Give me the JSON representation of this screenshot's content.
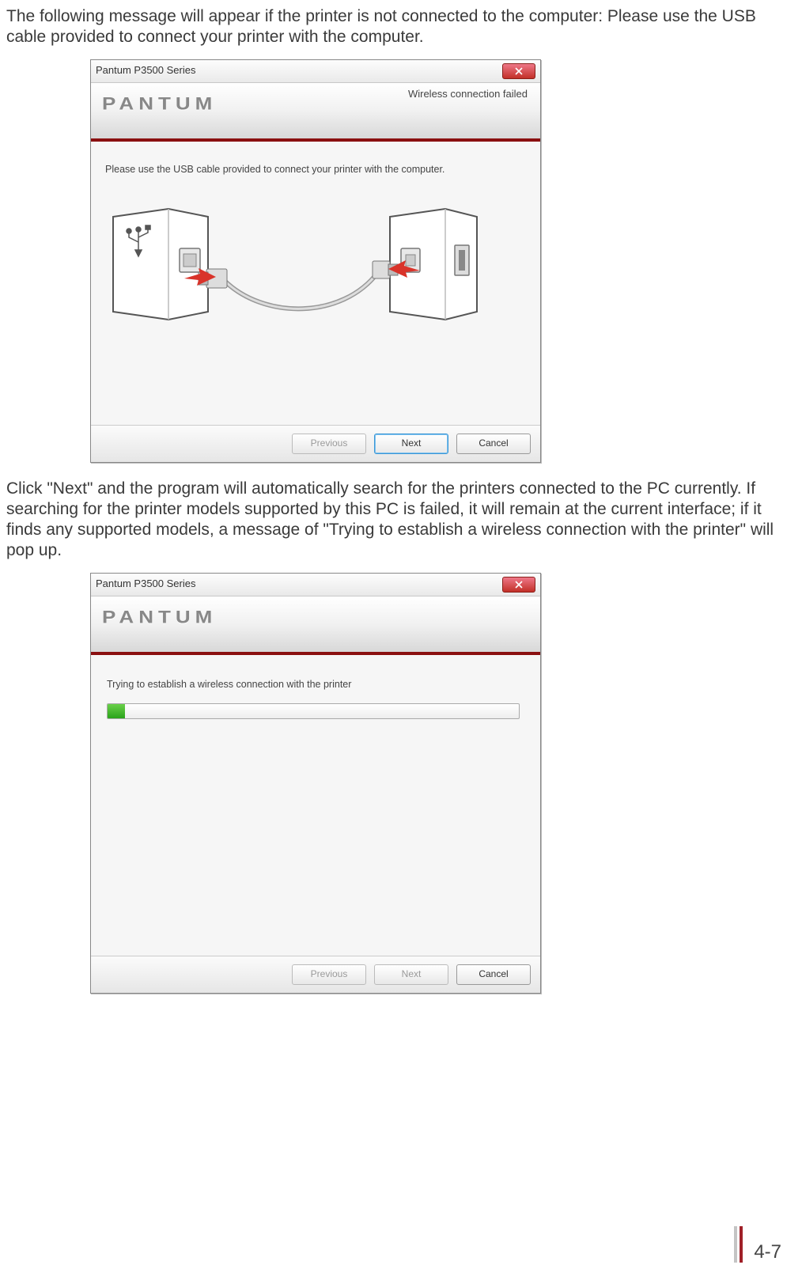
{
  "intro_text": "The following message will appear if the printer is not connected to the computer: Please use the USB cable provided to connect your printer with the computer.",
  "mid_text": "Click \"Next\" and the program will automatically search for the printers connected to the PC currently. If searching for the printer models supported by this PC is failed, it will remain at the current interface; if it finds any supported models, a message of \"Trying to establish a wireless connection with the printer\" will pop up.",
  "page_number": "4-7",
  "dialog1": {
    "title": "Pantum P3500 Series",
    "brand": "PANTUM",
    "status": "Wireless connection failed",
    "message": "Please use the USB cable provided to connect your printer with the computer.",
    "buttons": {
      "prev": "Previous",
      "next": "Next",
      "cancel": "Cancel"
    }
  },
  "dialog2": {
    "title": "Pantum P3500 Series",
    "brand": "PANTUM",
    "message": "Trying to establish a wireless connection with the printer",
    "progress_percent": 4,
    "buttons": {
      "prev": "Previous",
      "next": "Next",
      "cancel": "Cancel"
    }
  }
}
